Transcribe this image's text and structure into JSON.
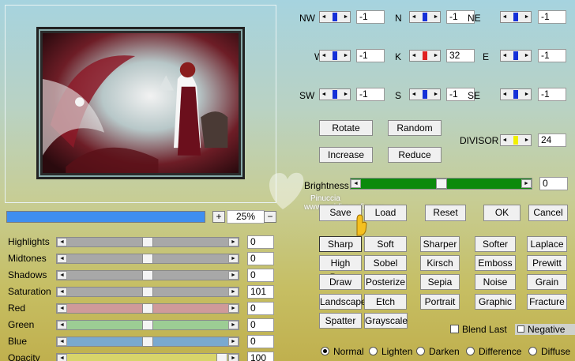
{
  "preview": {
    "zoom": "25%",
    "zoom_in": "+",
    "zoom_out": "−",
    "progress": 1.0
  },
  "sliders": [
    {
      "label": "Highlights",
      "value": "0",
      "level": 0.5,
      "color": "#a8a8a8"
    },
    {
      "label": "Midtones",
      "value": "0",
      "level": 0.5,
      "color": "#a8a8a8"
    },
    {
      "label": "Shadows",
      "value": "0",
      "level": 0.5,
      "color": "#a8a8a8"
    },
    {
      "label": "Saturation",
      "value": "101",
      "level": 0.5,
      "color": "#a8a8a8"
    },
    {
      "label": "Red",
      "value": "0",
      "level": 0.5,
      "color": "#cf9a9a"
    },
    {
      "label": "Green",
      "value": "0",
      "level": 0.5,
      "color": "#9ccd94"
    },
    {
      "label": "Blue",
      "value": "0",
      "level": 0.5,
      "color": "#7aa9cf"
    },
    {
      "label": "Opacity",
      "value": "100",
      "level": 1.0,
      "color": "#d8d46a"
    }
  ],
  "directions": [
    {
      "label": "NW",
      "value": "-1",
      "color": "#1530d8"
    },
    {
      "label": "N",
      "value": "-1",
      "color": "#1530d8"
    },
    {
      "label": "NE",
      "value": "-1",
      "color": "#1530d8"
    },
    {
      "label": "W",
      "value": "-1",
      "color": "#1530d8"
    },
    {
      "label": "K",
      "value": "32",
      "color": "#e02020"
    },
    {
      "label": "E",
      "value": "-1",
      "color": "#1530d8"
    },
    {
      "label": "SW",
      "value": "-1",
      "color": "#1530d8"
    },
    {
      "label": "S",
      "value": "-1",
      "color": "#1530d8"
    },
    {
      "label": "SE",
      "value": "-1",
      "color": "#1530d8"
    }
  ],
  "divisor": {
    "label": "DIVISOR",
    "value": "24",
    "color": "#f0f000"
  },
  "actions": {
    "rotate": "Rotate",
    "random": "Random",
    "increase": "Increase",
    "reduce": "Reduce"
  },
  "brightness": {
    "label": "Brightness",
    "value": "0",
    "level": 0.5,
    "color": "#0c8a0c"
  },
  "main_buttons": {
    "save": "Save",
    "load": "Load",
    "reset": "Reset",
    "ok": "OK",
    "cancel": "Cancel"
  },
  "presets": [
    "Sharp",
    "Soft",
    "Sharper",
    "Softer",
    "Laplace",
    "High Pass",
    "Sobel",
    "Kirsch",
    "Emboss",
    "Prewitt",
    "Draw",
    "Posterize",
    "Sepia",
    "Noise",
    "Grain",
    "Landscape",
    "Etch",
    "Portrait",
    "Graphic",
    "Fracture",
    "Spatter",
    "Grayscale"
  ],
  "checks": {
    "blend_last": "Blend Last",
    "negative": "Negative"
  },
  "blend_modes": {
    "selected": "Normal",
    "options": [
      "Normal",
      "Lighten",
      "Darken",
      "Difference",
      "Diffuse"
    ]
  },
  "watermark": {
    "name": "Pinuccia",
    "site": "www.maidiregrafica.eu"
  }
}
